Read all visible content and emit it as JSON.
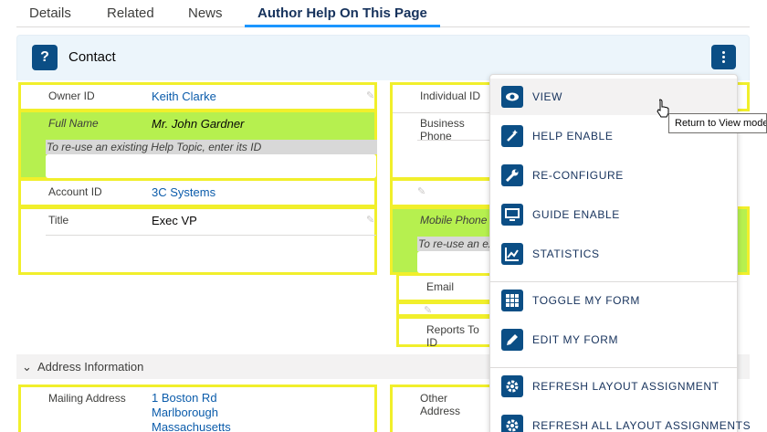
{
  "tabs": [
    {
      "label": "Details"
    },
    {
      "label": "Related"
    },
    {
      "label": "News"
    },
    {
      "label": "Author Help On This Page"
    }
  ],
  "card": {
    "help_glyph": "?",
    "title": "Contact"
  },
  "fields": {
    "owner_id": {
      "label": "Owner ID",
      "value": "Keith Clarke"
    },
    "full_name": {
      "label": "Full Name",
      "value": "Mr. John Gardner",
      "hint": "To re-use an existing Help Topic, enter its ID"
    },
    "account_id": {
      "label": "Account ID",
      "value": "3C Systems"
    },
    "title": {
      "label": "Title",
      "value": "Exec VP"
    },
    "individual_id": {
      "label": "Individual ID"
    },
    "business_phone": {
      "label": "Business Phone"
    },
    "mobile_phone": {
      "label": "Mobile Phone",
      "hint": "To re-use an ex"
    },
    "email": {
      "label": "Email"
    },
    "reports_to_id": {
      "label": "Reports To ID"
    },
    "mailing_address": {
      "label": "Mailing Address",
      "lines": [
        "1 Boston Rd",
        "Marlborough",
        "Massachusetts"
      ]
    },
    "other_address": {
      "label": "Other Address"
    }
  },
  "section": {
    "label": "Address Information"
  },
  "menu": {
    "items": [
      {
        "label": "VIEW",
        "icon": "eye-icon"
      },
      {
        "label": "HELP ENABLE",
        "icon": "magic-wand-icon"
      },
      {
        "label": "RE-CONFIGURE",
        "icon": "wrench-icon"
      },
      {
        "label": "GUIDE ENABLE",
        "icon": "monitor-icon"
      },
      {
        "label": "STATISTICS",
        "icon": "chart-icon"
      },
      {
        "label": "TOGGLE MY FORM",
        "icon": "grid-icon"
      },
      {
        "label": "EDIT MY FORM",
        "icon": "pencil-icon"
      },
      {
        "label": "REFRESH LAYOUT ASSIGNMENT",
        "icon": "gear-icon"
      },
      {
        "label": "REFRESH ALL LAYOUT ASSIGNMENTS",
        "icon": "gear-icon"
      }
    ]
  },
  "tooltip": {
    "text": "Return to View mode"
  },
  "colors": {
    "brand": "#0b4e85",
    "highlight_border": "#f1ef2b",
    "highlight_fill": "#b6f04f",
    "link": "#0b5cab",
    "active_tab_underline": "#1b96ff"
  }
}
